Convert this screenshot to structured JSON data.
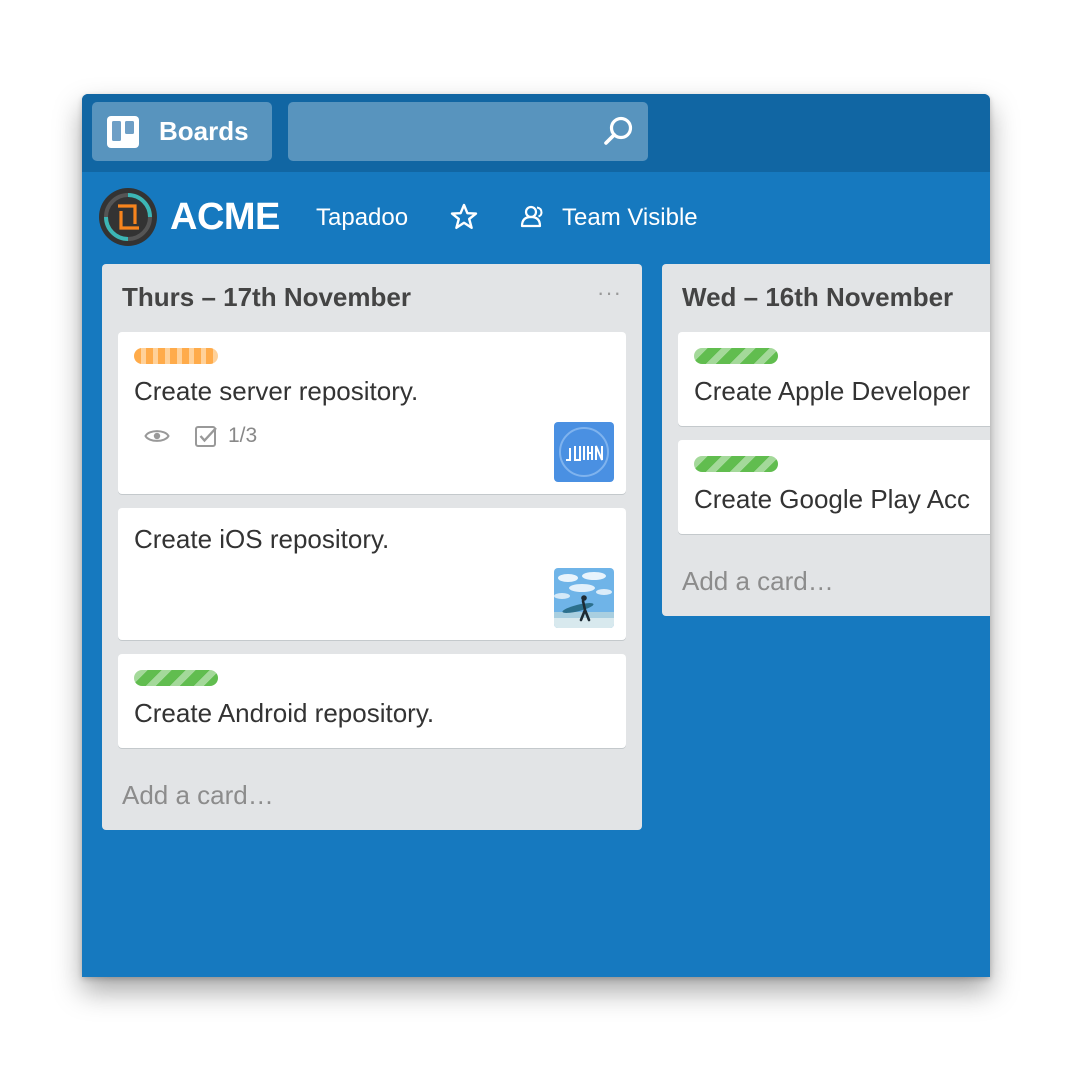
{
  "header": {
    "boards_label": "Boards",
    "search_value": ""
  },
  "board": {
    "title": "ACME",
    "team": "Tapadoo",
    "visibility": "Team Visible"
  },
  "lists": [
    {
      "title": "Thurs – 17th November",
      "menu": "···",
      "cards": [
        {
          "title": "Create server repository.",
          "label_color": "orange",
          "checklist": "1/3",
          "watching": true,
          "member": "JOHN"
        },
        {
          "title": "Create iOS repository.",
          "member": "surfer photo"
        },
        {
          "title": "Create Android repository.",
          "label_color": "green"
        }
      ],
      "add_card": "Add a card…"
    },
    {
      "title": "Wed – 16th November",
      "cards": [
        {
          "title": "Create Apple Developer",
          "label_color": "green"
        },
        {
          "title": "Create Google Play Acc",
          "label_color": "green"
        }
      ],
      "add_card": "Add a card…"
    }
  ],
  "colors": {
    "board_bg": "#1679bf",
    "topbar": "#1166a3",
    "label_orange": "#ffab4a",
    "label_green": "#61bd4f",
    "avatar_blue": "#4a90e2"
  }
}
